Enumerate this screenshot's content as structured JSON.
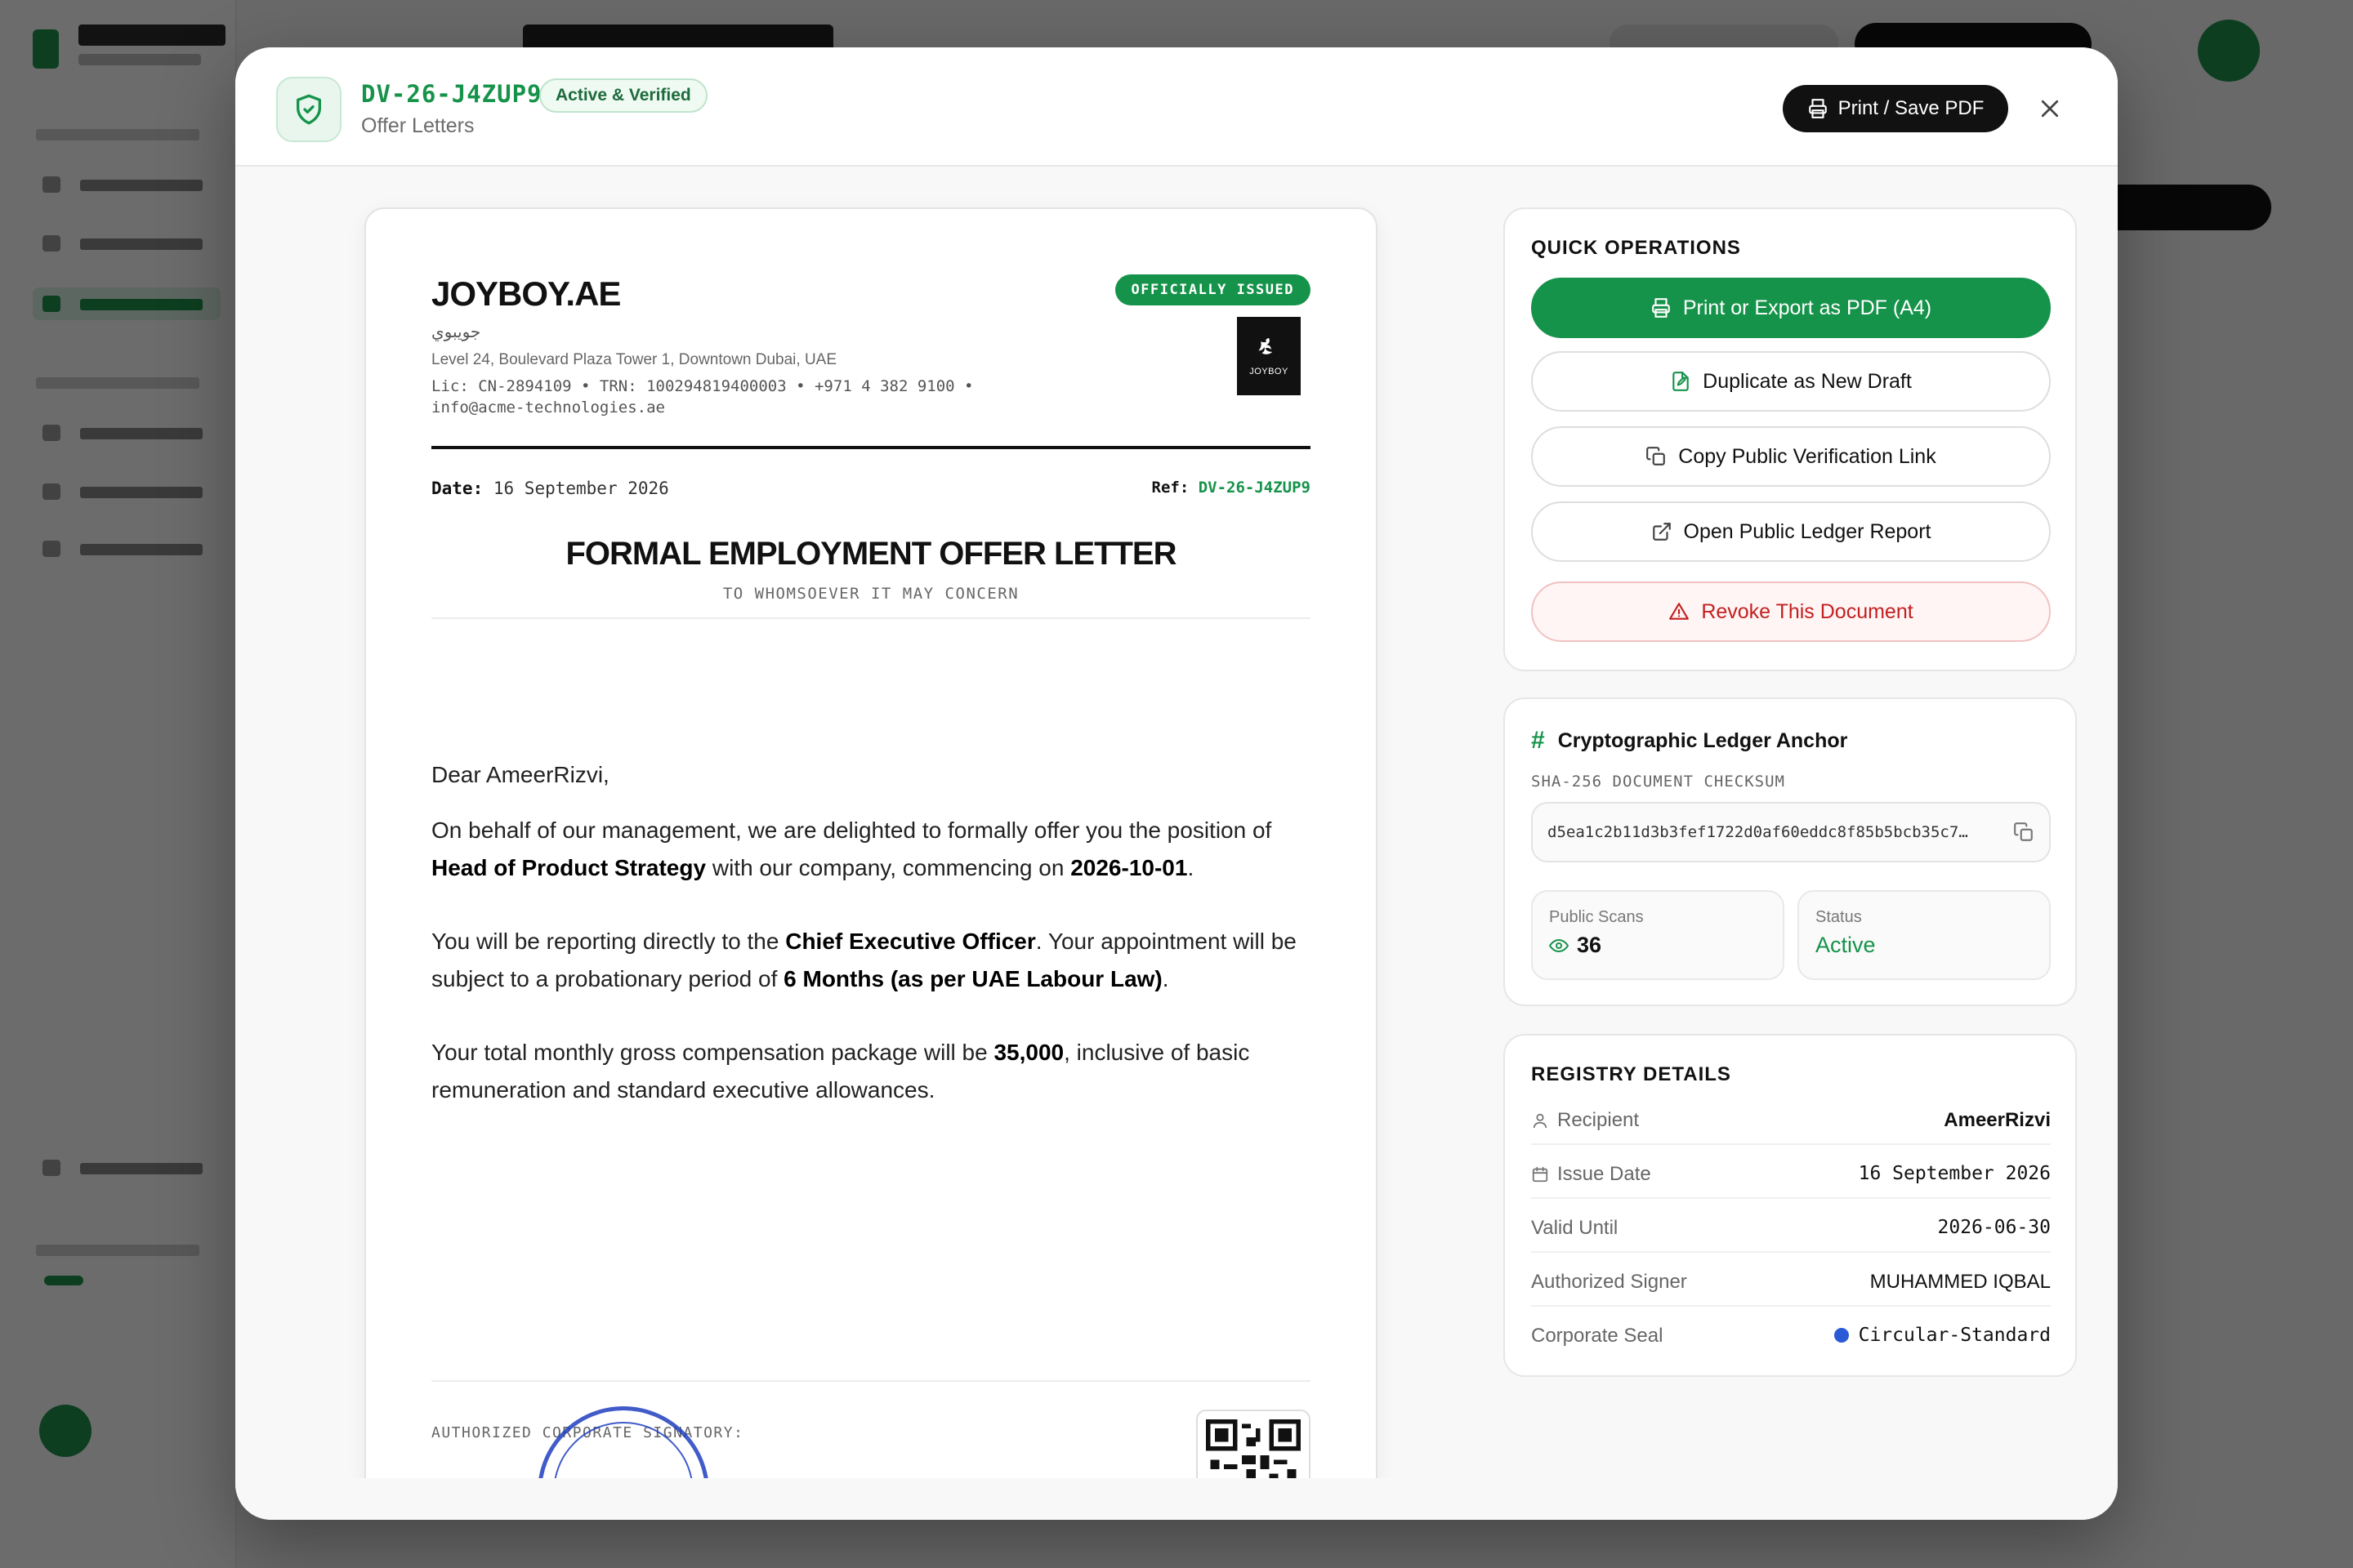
{
  "header": {
    "doc_id": "DV-26-J4ZUP9",
    "status": "Active & Verified",
    "category": "Offer Letters",
    "print_label": "Print / Save PDF"
  },
  "letter": {
    "company_name": "JOYBOY.AE",
    "company_arabic": "جويبوي",
    "address": "Level 24, Boulevard Plaza Tower 1, Downtown Dubai, UAE",
    "meta_line": "Lic: CN-2894109 • TRN: 100294819400003 • +971 4 382 9100 •",
    "email": "info@acme-technologies.ae",
    "badge": "OFFICIALLY ISSUED",
    "logo_text": "JOYBOY",
    "date_label": "Date:",
    "date_value": "16 September 2026",
    "ref_label": "Ref:",
    "ref_value": "DV-26-J4ZUP9",
    "title": "FORMAL EMPLOYMENT OFFER LETTER",
    "subtitle": "TO WHOMSOEVER IT MAY CONCERN",
    "salutation": "Dear AmeerRizvi,",
    "p1_a": "On behalf of our management, we are delighted to formally offer you the position of ",
    "p1_position": "Head of Product Strategy",
    "p1_b": " with our company, commencing on ",
    "p1_date": "2026-10-01",
    "p1_c": ".",
    "p2_a": "You will be reporting directly to the ",
    "p2_manager": "Chief Executive Officer",
    "p2_b": ". Your appointment will be subject to a probationary period of ",
    "p2_probation": "6 Months (as per UAE Labour Law)",
    "p2_c": ".",
    "p3_a": "Your total monthly gross compensation package will be ",
    "p3_amount": "35,000",
    "p3_b": ", inclusive of basic remuneration and standard executive allowances.",
    "signatory_label": "AUTHORIZED CORPORATE SIGNATORY:"
  },
  "quick_ops": {
    "title": "QUICK OPERATIONS",
    "print": "Print or Export as PDF (A4)",
    "duplicate": "Duplicate as New Draft",
    "copy_link": "Copy Public Verification Link",
    "open_report": "Open Public Ledger Report",
    "revoke": "Revoke This Document"
  },
  "ledger": {
    "title": "Cryptographic Ledger Anchor",
    "checksum_label": "SHA-256 DOCUMENT CHECKSUM",
    "checksum": "d5ea1c2b11d3b3fef1722d0af60eddc8f85b5bcb35c7…",
    "scans_label": "Public Scans",
    "scans_value": "36",
    "status_label": "Status",
    "status_value": "Active"
  },
  "registry": {
    "title": "REGISTRY DETAILS",
    "recipient_label": "Recipient",
    "recipient_value": "AmeerRizvi",
    "issue_label": "Issue Date",
    "issue_value": "16 September 2026",
    "valid_label": "Valid Until",
    "valid_value": "2026-06-30",
    "signer_label": "Authorized Signer",
    "signer_value": "MUHAMMED IQBAL",
    "seal_label": "Corporate Seal",
    "seal_value": "Circular-Standard"
  },
  "colors": {
    "accent": "#16934a",
    "danger": "#c22020",
    "seal": "#2a5ad6"
  }
}
